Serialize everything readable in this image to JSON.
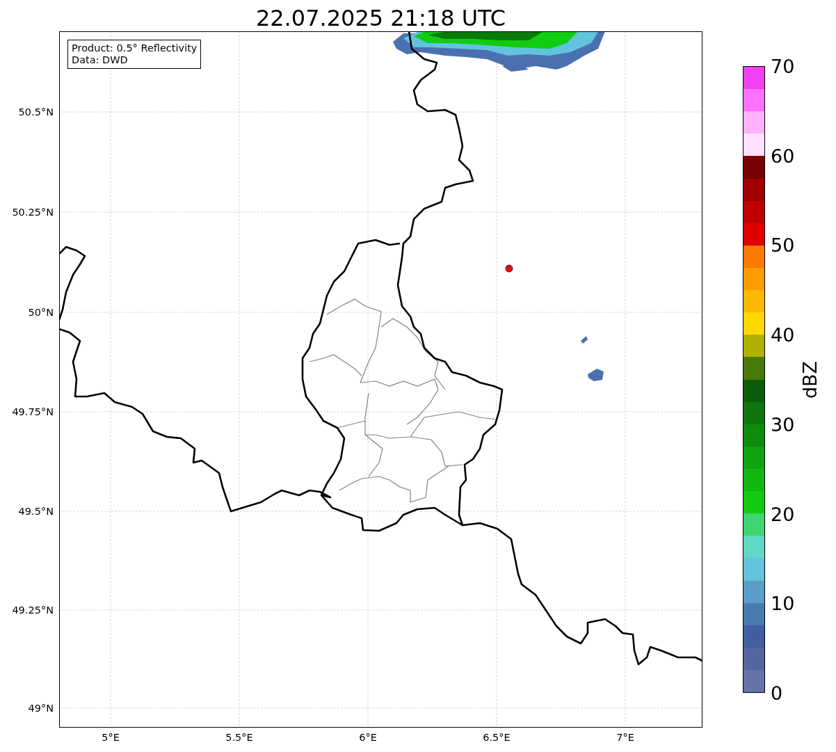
{
  "title": "22.07.2025 21:18 UTC",
  "legend": {
    "lines": [
      "Product: 0.5° Reflectivity",
      "Data: DWD"
    ]
  },
  "y_ticks": [
    "50.5°N",
    "50.25°N",
    "50°N",
    "49.75°N",
    "49.5°N",
    "49.25°N",
    "49°N"
  ],
  "x_ticks": [
    "5°E",
    "5.5°E",
    "6°E",
    "6.5°E",
    "7°E"
  ],
  "colorbar": {
    "label": "dBZ",
    "ticks": [
      "70",
      "60",
      "50",
      "40",
      "30",
      "20",
      "10",
      "0"
    ],
    "bins": [
      {
        "color": "#f040f0"
      },
      {
        "color": "#ff70ff"
      },
      {
        "color": "#ffb0ff"
      },
      {
        "color": "#ffe0ff"
      },
      {
        "color": "#780000"
      },
      {
        "color": "#a00000"
      },
      {
        "color": "#c00000"
      },
      {
        "color": "#e00000"
      },
      {
        "color": "#ff7a00"
      },
      {
        "color": "#ff9c00"
      },
      {
        "color": "#ffb800"
      },
      {
        "color": "#ffd800"
      },
      {
        "color": "#b0b000"
      },
      {
        "color": "#487a0a"
      },
      {
        "color": "#0a5e0a"
      },
      {
        "color": "#0d760d"
      },
      {
        "color": "#0d8c0d"
      },
      {
        "color": "#10a510"
      },
      {
        "color": "#10b810"
      },
      {
        "color": "#12cc12"
      },
      {
        "color": "#3dd670"
      },
      {
        "color": "#60d8c4"
      },
      {
        "color": "#63c2dc"
      },
      {
        "color": "#5a9ec8"
      },
      {
        "color": "#4a7ab0"
      },
      {
        "color": "#405ea0"
      },
      {
        "color": "#5466a0"
      },
      {
        "color": "#6474a8"
      }
    ]
  }
}
